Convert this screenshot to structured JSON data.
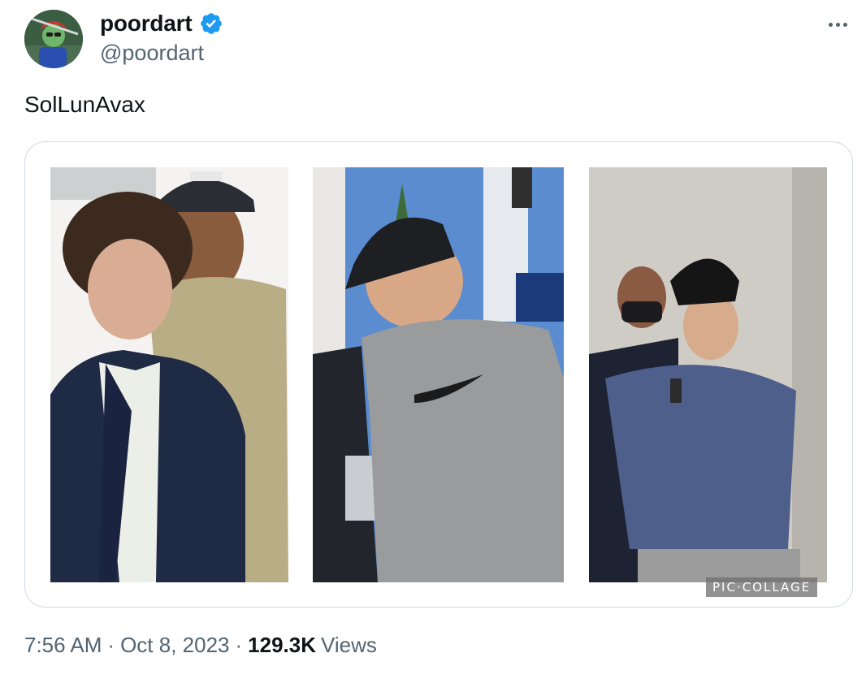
{
  "author": {
    "display_name": "poordart",
    "handle": "@poordart",
    "verified": true,
    "verified_color": "#1d9bf0"
  },
  "tweet": {
    "text": "SolLunAvax"
  },
  "media": {
    "watermark": "PIC·COLLAGE",
    "photo_count": 3
  },
  "meta": {
    "time": "7:56 AM",
    "separator": "·",
    "date": "Oct 8, 2023",
    "views_count": "129.3K",
    "views_label": "Views"
  },
  "icons": {
    "more": "more-horizontal-icon",
    "verified": "verified-badge-icon"
  }
}
